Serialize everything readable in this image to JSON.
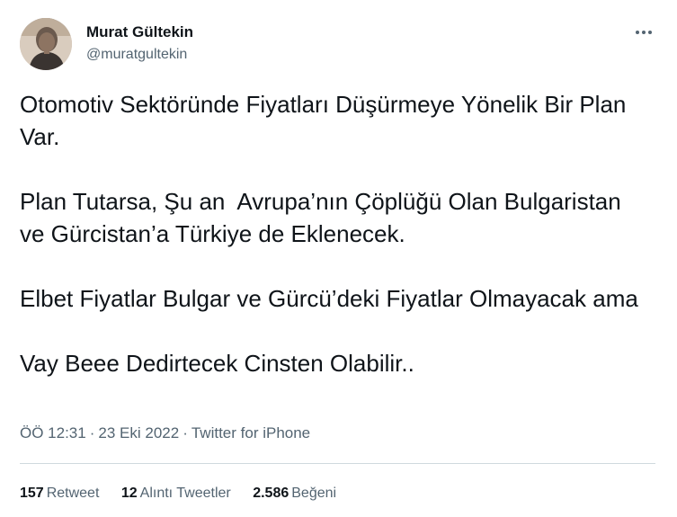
{
  "author": {
    "name": "Murat Gültekin",
    "handle": "@muratgultekin"
  },
  "tweet": {
    "paragraphs": [
      "Otomotiv Sektöründe Fiyatları Düşürmeye Yönelik Bir Plan Var.",
      "Plan Tutarsa, Şu an  Avrupa’nın Çöplüğü Olan Bulgaristan ve Gürcistan’a Türkiye de Eklenecek.",
      "Elbet Fiyatlar Bulgar ve Gürcü’deki Fiyatlar Olmayacak ama",
      "Vay Beee Dedirtecek Cinsten Olabilir.."
    ]
  },
  "meta": {
    "time": "ÖÖ 12:31",
    "date": "23 Eki 2022",
    "source": "Twitter for iPhone",
    "separator": "·"
  },
  "stats": {
    "retweets": {
      "count": "157",
      "label": "Retweet"
    },
    "quotes": {
      "count": "12",
      "label": "Alıntı Tweetler"
    },
    "likes": {
      "count": "2.586",
      "label": "Beğeni"
    }
  },
  "icons": {
    "more": "more-horizontal-icon"
  },
  "colors": {
    "text": "#0f1419",
    "secondary": "#536471",
    "divider": "#cfd9de"
  }
}
